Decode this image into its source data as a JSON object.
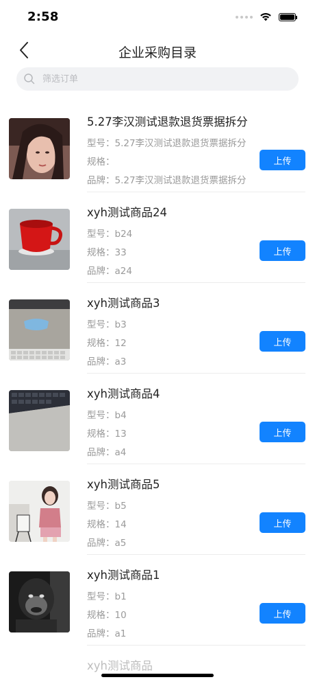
{
  "status_bar": {
    "time": "2:58"
  },
  "nav": {
    "title": "企业采购目录"
  },
  "search": {
    "placeholder": "筛选订单",
    "value": ""
  },
  "labels": {
    "model": "型号：",
    "spec": "规格：",
    "brand": "品牌：",
    "upload": "上传"
  },
  "items": [
    {
      "name": "5.27李汉测试退款退货票据拆分",
      "model": "5.27李汉测试退款退货票据拆分",
      "spec": "",
      "brand": "5.27李汉测试退款退货票据拆分",
      "image_icon": "portrait-photo"
    },
    {
      "name": "xyh测试商品24",
      "model": "b24",
      "spec": "33",
      "brand": "a24",
      "image_icon": "red-mug-photo"
    },
    {
      "name": "xyh测试商品3",
      "model": "b3",
      "spec": "12",
      "brand": "a3",
      "image_icon": "desk-keyboard-photo"
    },
    {
      "name": "xyh测试商品4",
      "model": "b4",
      "spec": "13",
      "brand": "a4",
      "image_icon": "keyboard-photo"
    },
    {
      "name": "xyh测试商品5",
      "model": "b5",
      "spec": "14",
      "brand": "a5",
      "image_icon": "woman-photo"
    },
    {
      "name": "xyh测试商品1",
      "model": "b1",
      "spec": "10",
      "brand": "a1",
      "image_icon": "chimp-photo"
    }
  ],
  "partial_item": {
    "name": "xyh测试商品"
  },
  "colors": {
    "accent": "#1283ff",
    "search_bg": "#f1f2f4",
    "secondary_text": "#9a9a9a"
  }
}
